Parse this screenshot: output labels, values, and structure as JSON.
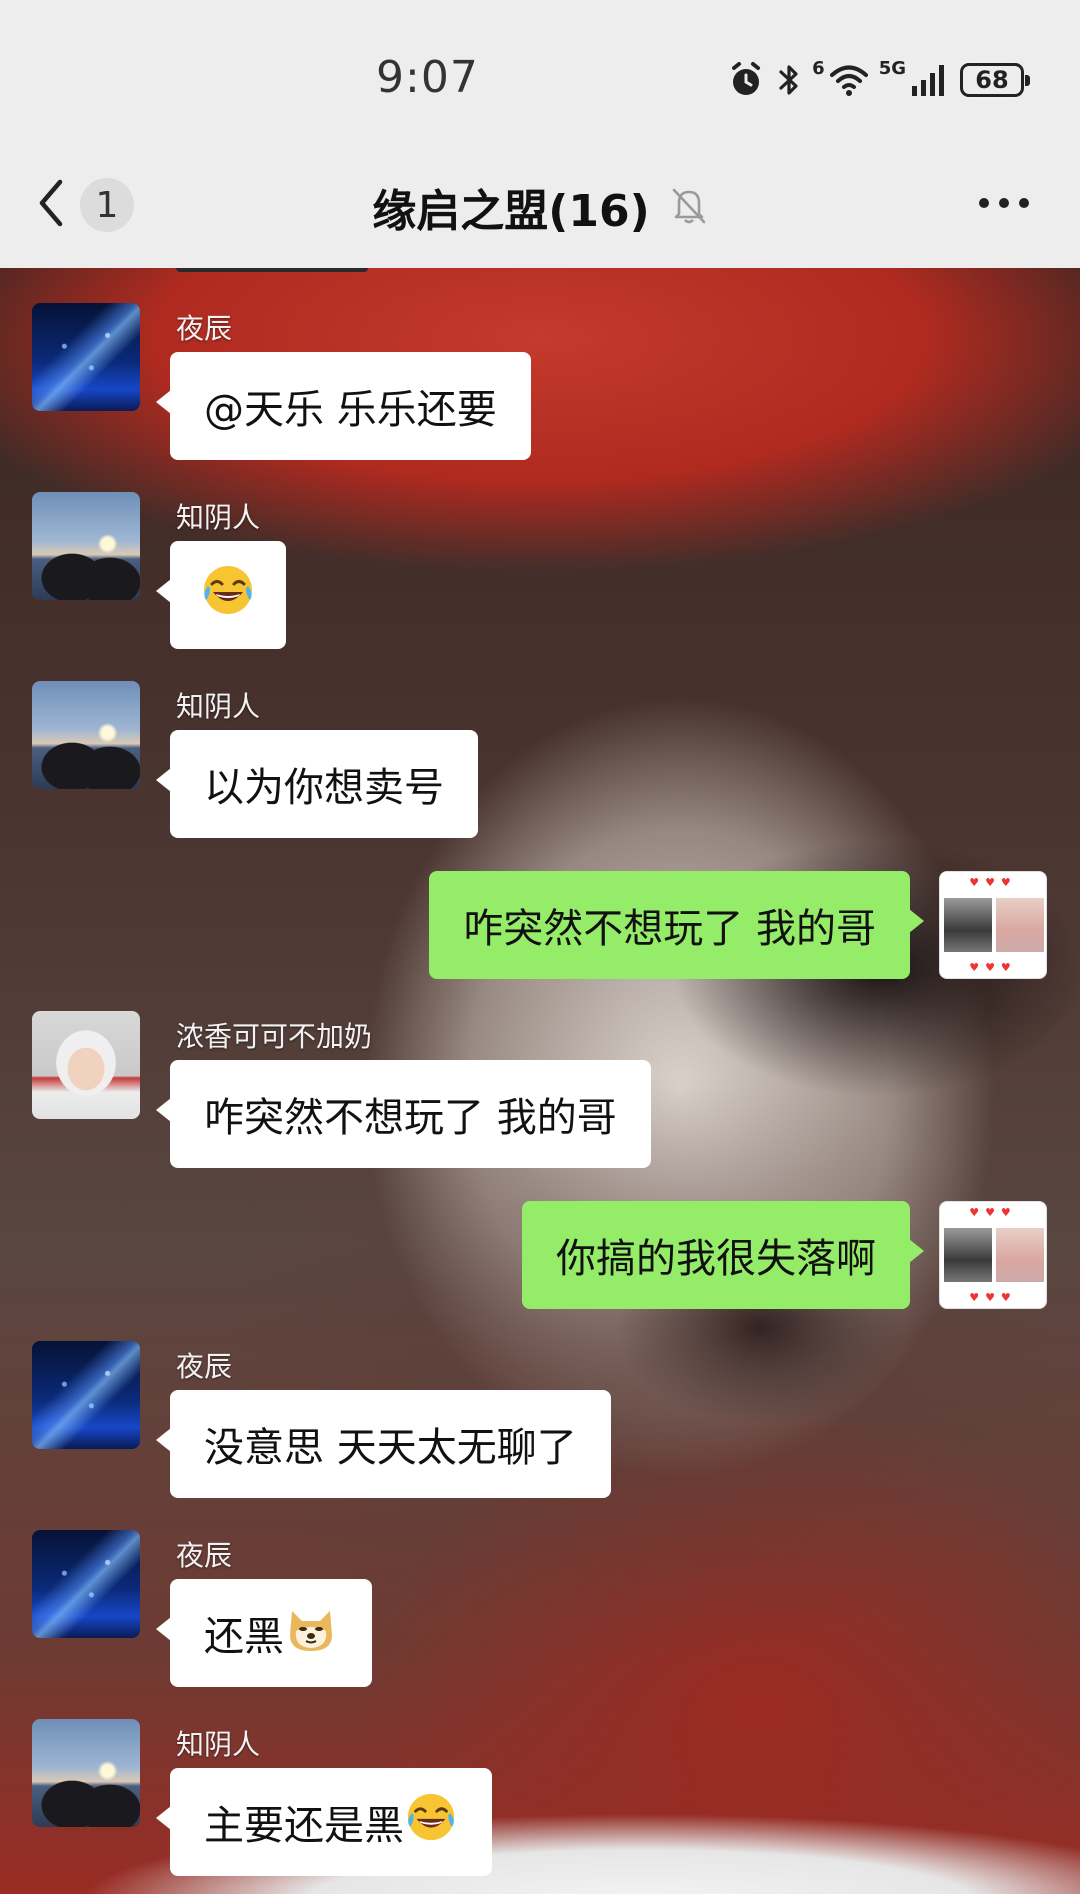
{
  "status_bar": {
    "time": "9:07",
    "network_label": "5G",
    "wifi_label": "6",
    "battery": "68",
    "icons": [
      "alarm-icon",
      "bluetooth-icon",
      "wifi-icon",
      "signal-icon",
      "battery-icon"
    ]
  },
  "nav": {
    "back_icon": "chevron-left-icon",
    "unread_count": "1",
    "title": "缘启之盟(16)",
    "mute_icon": "bell-off-icon",
    "more_icon": "more-horizontal-icon"
  },
  "colors": {
    "outgoing_bubble": "#95ec69",
    "incoming_bubble": "#ffffff",
    "header_bg": "#ededed"
  },
  "messages": [
    {
      "direction": "in",
      "sender": "夜辰",
      "avatar": "starry-sky-avatar",
      "text": "@天乐  乐乐还要"
    },
    {
      "direction": "in",
      "sender": "知阴人",
      "avatar": "sunset-couple-avatar",
      "text": "",
      "emoji": "tears-of-joy"
    },
    {
      "direction": "in",
      "sender": "知阴人",
      "avatar": "sunset-couple-avatar",
      "text": "以为你想卖号"
    },
    {
      "direction": "out",
      "sender": "",
      "avatar": "own-avatar",
      "text": "咋突然不想玩了  我的哥"
    },
    {
      "direction": "in",
      "sender": "浓香可可不加奶",
      "avatar": "girl-avatar",
      "text": "咋突然不想玩了  我的哥"
    },
    {
      "direction": "out",
      "sender": "",
      "avatar": "own-avatar",
      "text": "你搞的我很失落啊"
    },
    {
      "direction": "in",
      "sender": "夜辰",
      "avatar": "starry-sky-avatar",
      "text": "没意思 天天太无聊了"
    },
    {
      "direction": "in",
      "sender": "夜辰",
      "avatar": "starry-sky-avatar",
      "text": "还黑",
      "emoji": "doge"
    },
    {
      "direction": "in",
      "sender": "知阴人",
      "avatar": "sunset-couple-avatar",
      "text": "主要还是黑",
      "emoji": "tears-of-joy"
    }
  ]
}
